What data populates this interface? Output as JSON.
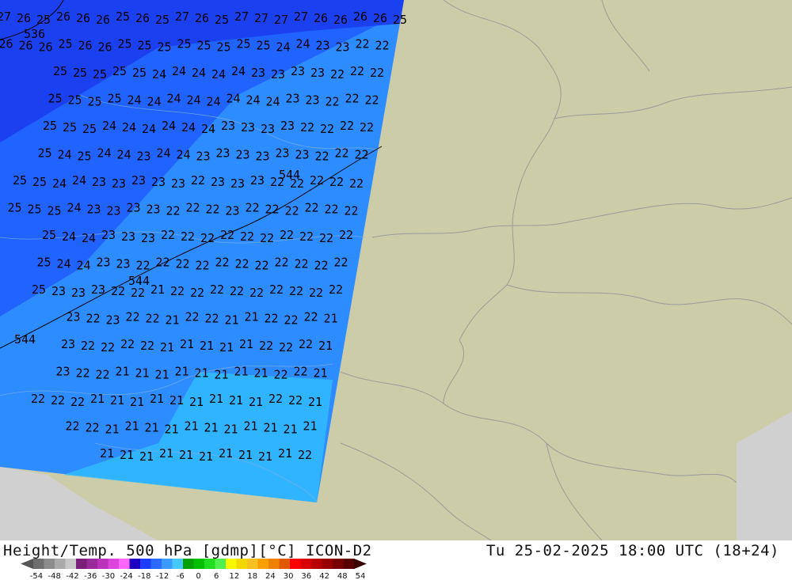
{
  "map": {
    "land_color": "#cccca8",
    "sea_color": "#d0d0d0",
    "isolines": [
      {
        "label": "536",
        "value": 536
      },
      {
        "label": "544",
        "value": 544
      }
    ],
    "temperature_labels": [
      {
        "row": 0,
        "values": [
          27,
          26,
          25,
          26,
          26,
          26,
          25,
          26,
          25,
          27,
          26,
          25,
          27,
          27,
          27,
          27,
          26,
          26,
          26,
          26,
          25
        ]
      },
      {
        "row": 1,
        "values": [
          26,
          26,
          26,
          25,
          26,
          26,
          25,
          25,
          25,
          25,
          25,
          25,
          25,
          25,
          24,
          24,
          23,
          23,
          22,
          22
        ]
      },
      {
        "row": 2,
        "values": [
          25,
          25,
          25,
          25,
          25,
          24,
          24,
          24,
          24,
          24,
          23,
          23,
          23,
          23,
          22,
          22,
          22
        ]
      },
      {
        "row": 3,
        "values": [
          25,
          25,
          25,
          25,
          24,
          24,
          24,
          24,
          24,
          24,
          24,
          24,
          23,
          23,
          22,
          22,
          22
        ]
      },
      {
        "row": 4,
        "values": [
          25,
          25,
          25,
          24,
          24,
          24,
          24,
          24,
          24,
          23,
          23,
          23,
          23,
          22,
          22,
          22,
          22
        ]
      },
      {
        "row": 5,
        "values": [
          25,
          24,
          25,
          24,
          24,
          23,
          24,
          24,
          23,
          23,
          23,
          23,
          23,
          23,
          22,
          22,
          22
        ]
      },
      {
        "row": 6,
        "values": [
          25,
          25,
          24,
          24,
          23,
          23,
          23,
          23,
          23,
          22,
          23,
          23,
          23,
          22,
          22,
          22,
          22,
          22
        ]
      },
      {
        "row": 7,
        "values": [
          25,
          25,
          25,
          24,
          23,
          23,
          23,
          23,
          22,
          22,
          22,
          23,
          22,
          22,
          22,
          22,
          22,
          22
        ]
      },
      {
        "row": 8,
        "values": [
          25,
          24,
          24,
          23,
          23,
          23,
          22,
          22,
          22,
          22,
          22,
          22,
          22,
          22,
          22,
          22
        ]
      },
      {
        "row": 9,
        "values": [
          25,
          24,
          24,
          23,
          23,
          22,
          22,
          22,
          22,
          22,
          22,
          22,
          22,
          22,
          22,
          22
        ]
      },
      {
        "row": 10,
        "values": [
          25,
          23,
          23,
          23,
          22,
          22,
          21,
          22,
          22,
          22,
          22,
          22,
          22,
          22,
          22,
          22
        ]
      },
      {
        "row": 11,
        "values": [
          23,
          22,
          23,
          22,
          22,
          21,
          22,
          22,
          21,
          21,
          22,
          22,
          22,
          21
        ]
      },
      {
        "row": 12,
        "values": [
          23,
          22,
          22,
          22,
          22,
          21,
          21,
          21,
          21,
          21,
          22,
          22,
          22,
          21
        ]
      },
      {
        "row": 13,
        "values": [
          23,
          22,
          22,
          21,
          21,
          21,
          21,
          21,
          21,
          21,
          21,
          22,
          22,
          21
        ]
      },
      {
        "row": 14,
        "values": [
          22,
          22,
          22,
          21,
          21,
          21,
          21,
          21,
          21,
          21,
          21,
          21,
          22,
          22,
          21
        ]
      },
      {
        "row": 15,
        "values": [
          22,
          22,
          21,
          21,
          21,
          21,
          21,
          21,
          21,
          21,
          21,
          21,
          21
        ]
      },
      {
        "row": 16,
        "values": [
          21,
          21,
          21,
          21,
          21,
          21,
          21,
          21,
          21,
          21,
          22
        ]
      }
    ]
  },
  "footer": {
    "title_left": "Height/Temp. 500 hPa [gdmp][°C] ICON-D2",
    "title_right": "Tu 25-02-2025 18:00 UTC (18+24)",
    "legend": {
      "ticks": [
        "-54",
        "-48",
        "-42",
        "-36",
        "-30",
        "-24",
        "-18",
        "-12",
        "-6",
        "0",
        "6",
        "12",
        "18",
        "24",
        "30",
        "36",
        "42",
        "48",
        "54"
      ],
      "colors": [
        "#6e6e6e",
        "#8c8c8c",
        "#aaaaaa",
        "#c8c8c8",
        "#7a1f7a",
        "#9a2a9a",
        "#bb33bb",
        "#dd44dd",
        "#ff66ff",
        "#2000c0",
        "#1c3cff",
        "#2a6aff",
        "#3a9aff",
        "#44c8ff",
        "#00a000",
        "#00be00",
        "#20dd20",
        "#50f050",
        "#f8f800",
        "#f0d800",
        "#f8c020",
        "#f8a000",
        "#f08000",
        "#e05800",
        "#ff0000",
        "#d80000",
        "#b80000",
        "#980000",
        "#780000",
        "#580000"
      ]
    }
  }
}
